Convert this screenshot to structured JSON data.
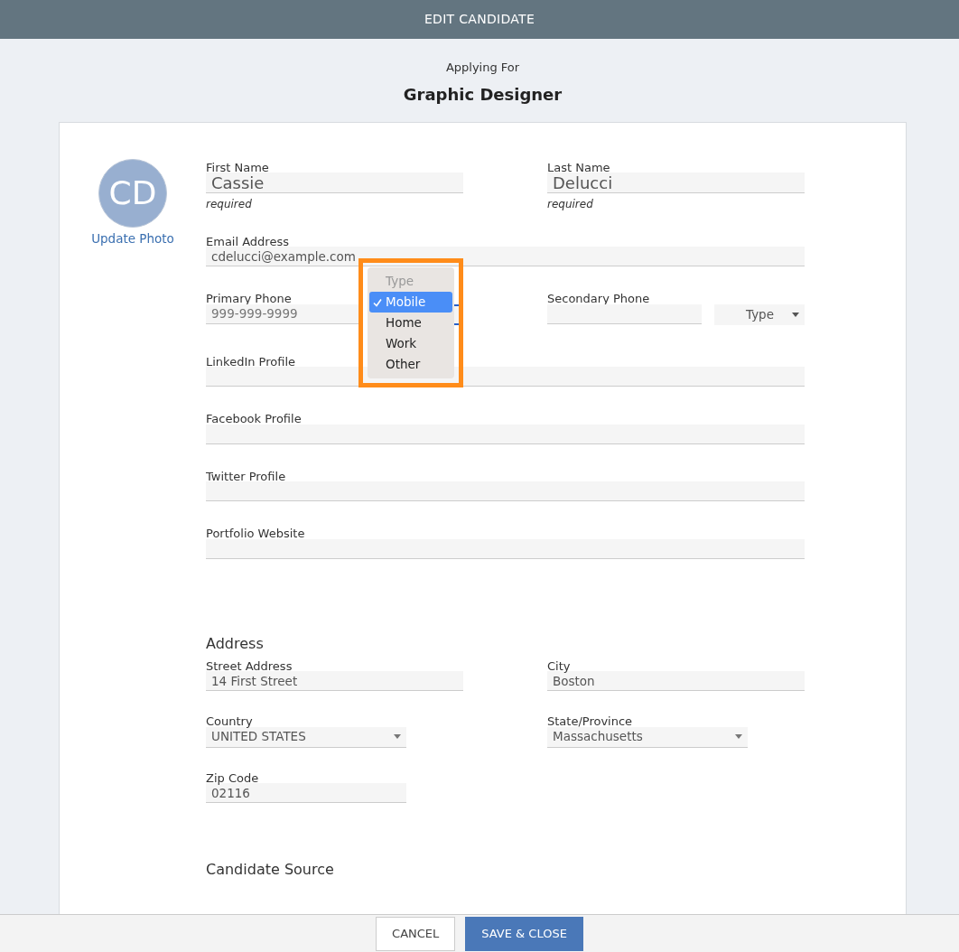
{
  "header": {
    "title": "EDIT CANDIDATE"
  },
  "applying": {
    "label": "Applying For",
    "position": "Graphic Designer"
  },
  "avatar": {
    "initials": "CD",
    "link": "Update Photo"
  },
  "name_fields": [
    {
      "label": "First Name",
      "value": "Cassie",
      "note": "required"
    },
    {
      "label": "Last Name",
      "value": "Delucci",
      "note": "required"
    }
  ],
  "email": {
    "label": "Email Address",
    "value": "cdelucci@example.com"
  },
  "phones": [
    {
      "label": "Primary Phone",
      "placeholder": "999-999-9999",
      "open": true,
      "focused": true,
      "menu": {
        "callout": true,
        "options": [
          {
            "label": "Type",
            "disabled": true,
            "selected": false
          },
          {
            "label": "Mobile",
            "disabled": false,
            "selected": true
          },
          {
            "label": "Home",
            "disabled": false,
            "selected": false
          },
          {
            "label": "Work",
            "disabled": false,
            "selected": false
          },
          {
            "label": "Other",
            "disabled": false,
            "selected": false
          }
        ]
      }
    },
    {
      "label": "Secondary Phone",
      "type": "Type",
      "open": false,
      "focused": false
    }
  ],
  "profiles": [
    {
      "label": "LinkedIn Profile"
    },
    {
      "label": "Facebook Profile"
    },
    {
      "label": "Twitter Profile"
    },
    {
      "label": "Portfolio Website"
    }
  ],
  "address": {
    "heading": "Address",
    "fields": [
      {
        "label": "Street Address",
        "value": "14 First Street",
        "kind": "text"
      },
      {
        "label": "City",
        "value": "Boston",
        "kind": "text"
      },
      {
        "label": "Country",
        "value": "UNITED STATES",
        "kind": "select"
      },
      {
        "label": "State/Province",
        "value": "Massachusetts",
        "kind": "select"
      },
      {
        "label": "Zip Code",
        "value": "02116",
        "kind": "short"
      }
    ]
  },
  "next_section": {
    "heading": "Candidate Source"
  },
  "footer": {
    "buttons": [
      {
        "label": "CANCEL",
        "kind": "secondary"
      },
      {
        "label": "SAVE & CLOSE",
        "kind": "primary"
      }
    ]
  }
}
